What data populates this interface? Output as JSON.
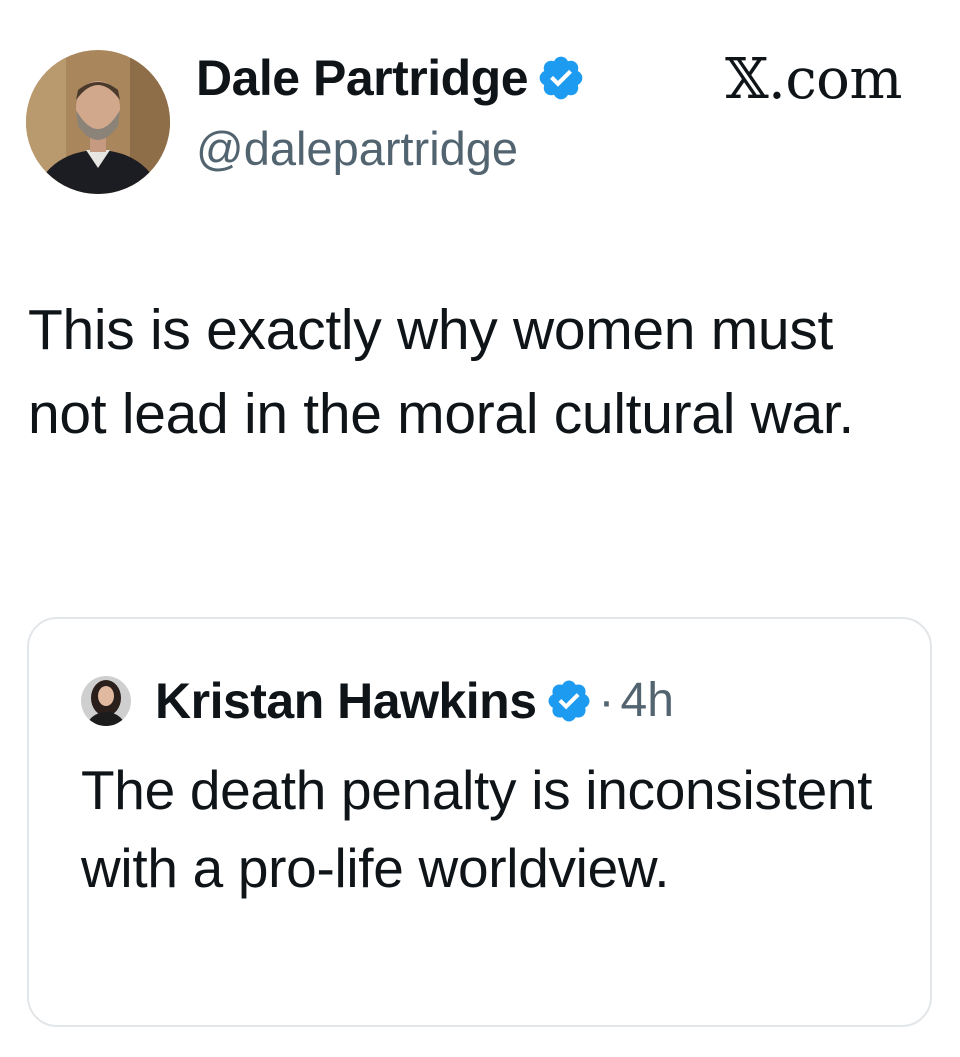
{
  "colors": {
    "text_primary": "#0f1419",
    "text_secondary": "#536471",
    "verified_badge": "#1d9bf0",
    "card_border": "#e3e6e9"
  },
  "site_label": "𝕏.com",
  "author": {
    "display_name": "Dale Partridge",
    "handle": "@dalepartridge",
    "verified": true,
    "avatar_icon": "profile-photo"
  },
  "tweet": {
    "text": "This is exactly why women must not lead in the moral cultural war."
  },
  "quoted_tweet": {
    "display_name": "Kristan Hawkins",
    "verified": true,
    "separator": "·",
    "time": "4h",
    "text": "The death penalty is inconsistent with a pro-life worldview.",
    "avatar_icon": "profile-photo"
  }
}
